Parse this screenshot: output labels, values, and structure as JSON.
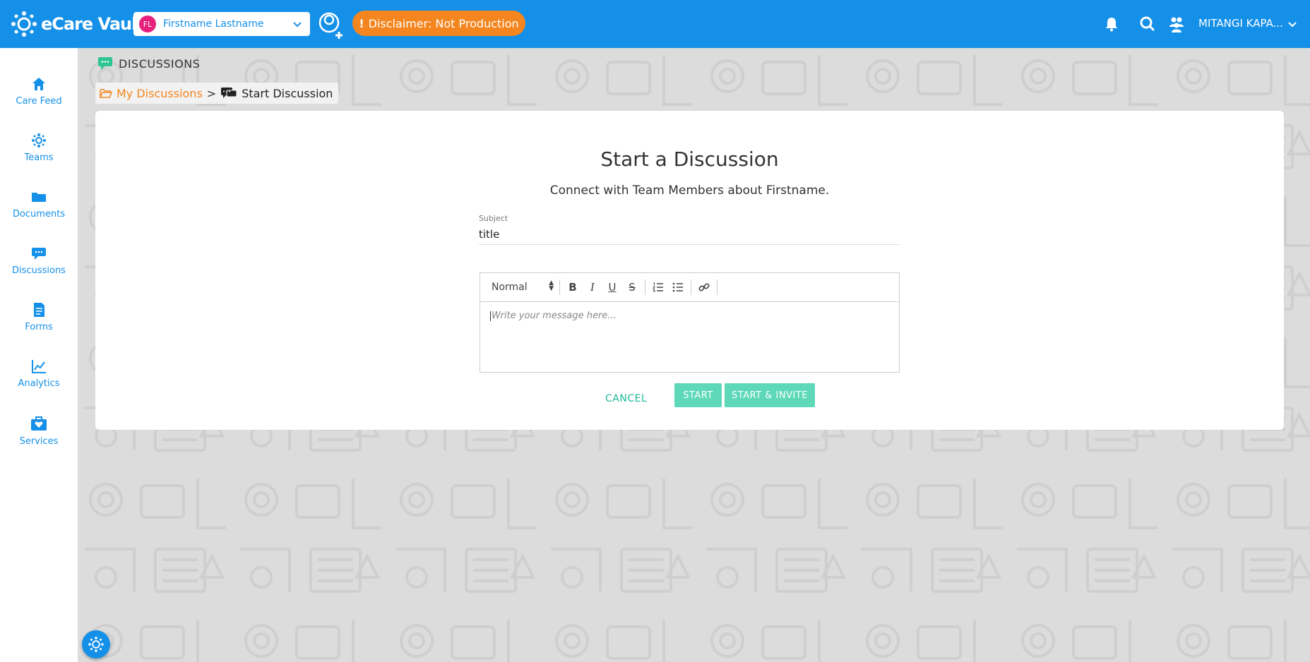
{
  "brand": {
    "name": "eCare Vault"
  },
  "header": {
    "patient": {
      "initials": "FL",
      "name": "Firstname Lastname"
    },
    "disclaimer": {
      "mark": "!",
      "text": "Disclaimer: Not Production"
    },
    "user": {
      "name": "MITANGI KAPA..."
    }
  },
  "sidebar": {
    "items": [
      {
        "label": "Care Feed",
        "icon": "home-icon"
      },
      {
        "label": "Teams",
        "icon": "teams-icon"
      },
      {
        "label": "Documents",
        "icon": "folder-icon"
      },
      {
        "label": "Discussions",
        "icon": "discussions-icon"
      },
      {
        "label": "Forms",
        "icon": "forms-icon"
      },
      {
        "label": "Analytics",
        "icon": "analytics-icon"
      },
      {
        "label": "Services",
        "icon": "services-icon"
      }
    ]
  },
  "section": {
    "title": "DISCUSSIONS"
  },
  "breadcrumb": {
    "parent": "My Discussions",
    "separator": ">",
    "current": "Start Discussion"
  },
  "form": {
    "title": "Start a Discussion",
    "subtitle": "Connect with Team Members about Firstname.",
    "subject_label": "Subject",
    "subject_value": "title",
    "editor": {
      "format": "Normal",
      "placeholder": "Write your message here...",
      "toolbar": {
        "bold": "B",
        "italic": "I",
        "underline": "U",
        "strike": "S"
      }
    },
    "buttons": {
      "cancel": "CANCEL",
      "start": "START",
      "start_invite": "START & INVITE"
    }
  },
  "colors": {
    "primary": "#1590e8",
    "accent": "#f5861f",
    "action": "#5dd8b8",
    "link": "#1fb99a"
  }
}
